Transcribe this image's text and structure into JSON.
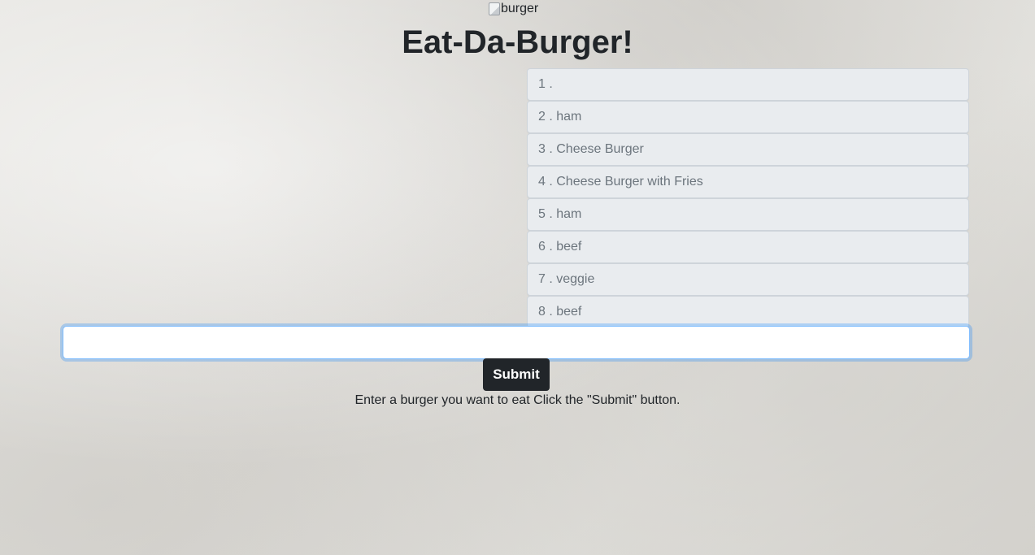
{
  "header": {
    "logo_alt": "burger",
    "title": "Eat-Da-Burger!"
  },
  "burgers": [
    {
      "label": "1 ."
    },
    {
      "label": "2 . ham"
    },
    {
      "label": "3 . Cheese Burger"
    },
    {
      "label": "4 . Cheese Burger with Fries"
    },
    {
      "label": "5 . ham"
    },
    {
      "label": "6 . beef"
    },
    {
      "label": "7 . veggie"
    },
    {
      "label": "8 . beef"
    }
  ],
  "form": {
    "input_value": "",
    "submit_label": "Submit",
    "instructions": "Enter a burger you want to eat Click the \"Submit\" button."
  }
}
